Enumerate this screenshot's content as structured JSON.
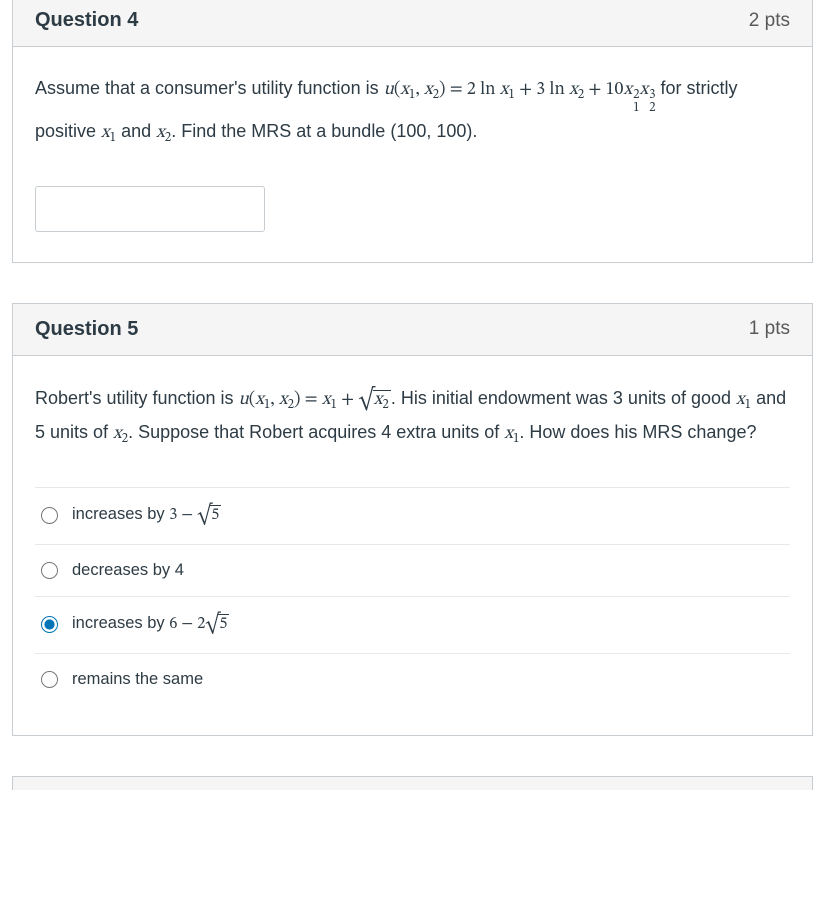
{
  "q4": {
    "title": "Question 4",
    "pts": "2 pts",
    "prompt_pre": "Assume that a consumer's utility function is ",
    "prompt_post1": " for strictly positive ",
    "prompt_post2": " and ",
    "prompt_post3": ". Find the MRS at a bundle (100, 100).",
    "answer_value": ""
  },
  "q5": {
    "title": "Question 5",
    "pts": "1 pts",
    "prompt_pre": "Robert's utility function is ",
    "prompt_mid1": ". His initial endowment was 3 units of good ",
    "prompt_mid2": " and 5 units of ",
    "prompt_mid3": ". Suppose that Robert acquires 4 extra units of ",
    "prompt_mid4": ". How does his MRS change?",
    "options": {
      "a": {
        "pre": "increases by ",
        "math": "3 − √5"
      },
      "b": {
        "text": "decreases by 4"
      },
      "c": {
        "pre": "increases by ",
        "math": "6 − 2√5"
      },
      "d": {
        "text": "remains the same"
      }
    },
    "selected": "c"
  }
}
